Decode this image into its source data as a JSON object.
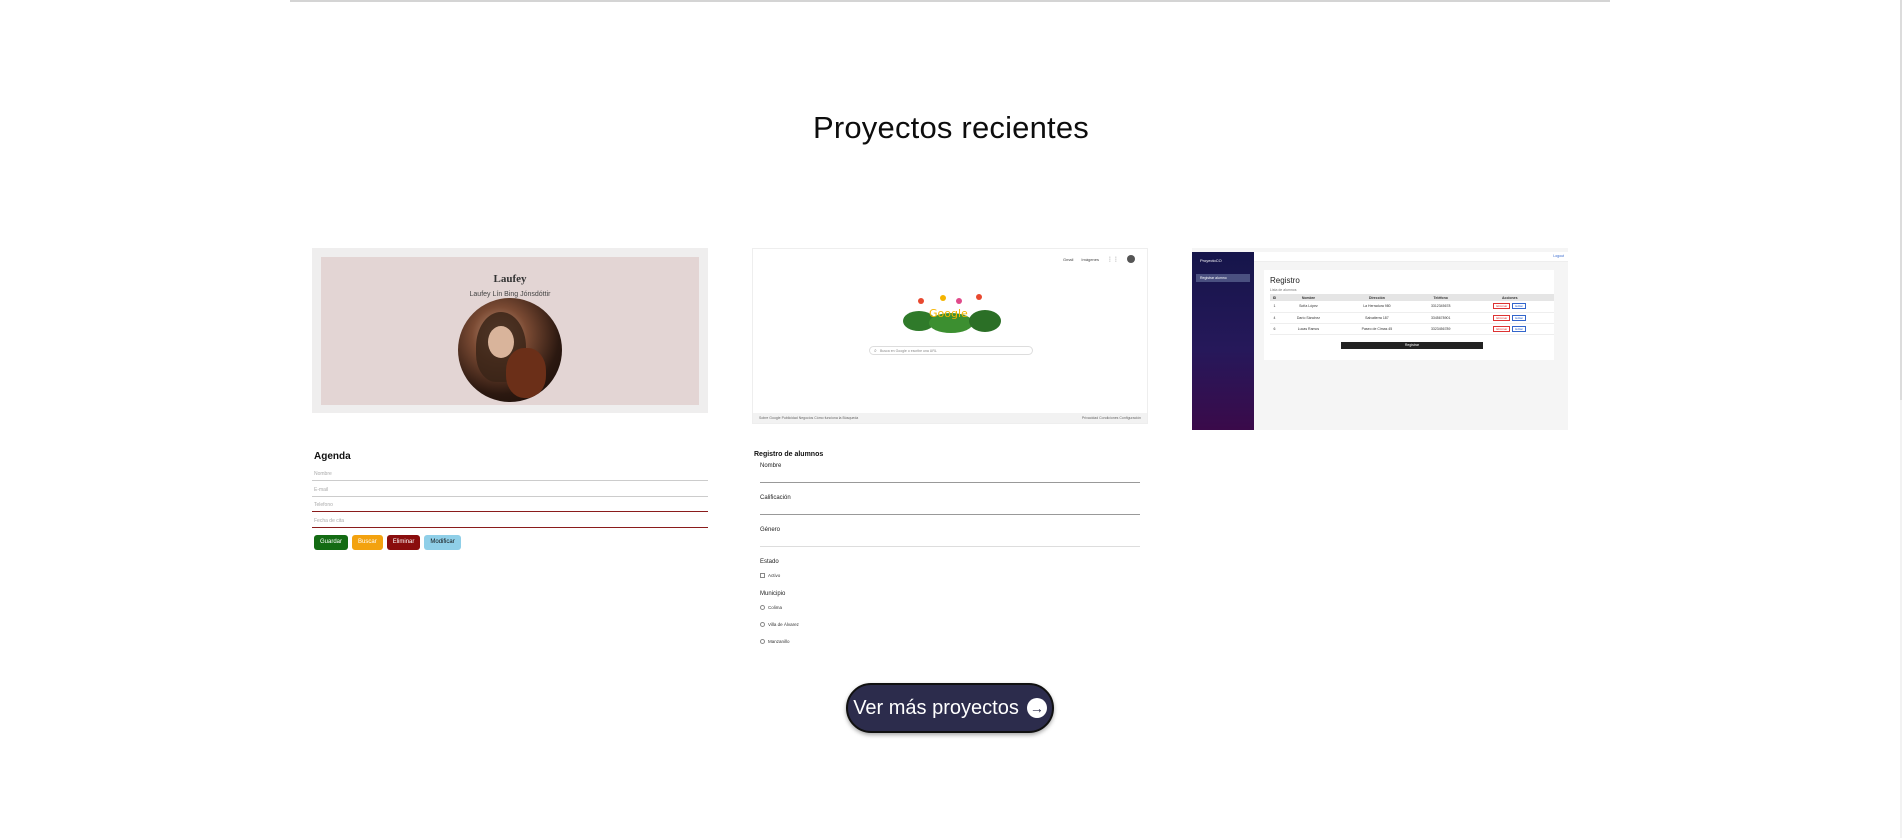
{
  "section": {
    "title": "Proyectos recientes"
  },
  "cards": {
    "laufey": {
      "name": "Laufey",
      "subtitle": "Laufey Lín Bing Jónsdóttir"
    },
    "google": {
      "toplinks": [
        "Gmail",
        "Imágenes"
      ],
      "search_placeholder": "Busca en Google o escribe una URL",
      "footer_left": "Sobre Google   Publicidad   Negocios   Cómo funciona la Búsqueda",
      "footer_right": "Privacidad   Condiciones   Configuración"
    },
    "registro": {
      "brand": "ProyectoCO",
      "nav_item": "Registrar alumno",
      "logout": "Logout",
      "title": "Registro",
      "subtitle": "Lista de alumnos",
      "columns": [
        "ID",
        "Nombre",
        "Dirección",
        "Teléfono",
        "Acciones"
      ],
      "rows": [
        [
          "1",
          "Sofía López",
          "La Herradura 980",
          "3312345678",
          [
            "Eliminar",
            "Editar"
          ]
        ],
        [
          "4",
          "Darío Sánchez",
          "Salvatierra 187",
          "3345678901",
          [
            "Eliminar",
            "Editar"
          ]
        ],
        [
          "6",
          "Lucas Ramos",
          "Paseo de Cimas 45",
          "3323456789",
          [
            "Eliminar",
            "Editar"
          ]
        ]
      ],
      "register_button": "Registrar"
    }
  },
  "agenda": {
    "title": "Agenda",
    "placeholders": [
      "Nombre",
      "E-mail",
      "Telefono",
      "Fecha de cita"
    ],
    "buttons": {
      "save": "Guardar",
      "find": "Buscar",
      "delete": "Eliminar",
      "modify": "Modificar"
    }
  },
  "alumnos": {
    "title": "Registro de alumnos",
    "labels": {
      "name": "Nombre",
      "grade": "Calificación",
      "gender": "Género",
      "status": "Estado",
      "municipality": "Municipio"
    },
    "status_option": "Activo",
    "municipalities": [
      "Colima",
      "Villa de Álvarez",
      "Manzanillo"
    ]
  },
  "cta": {
    "label": "Ver más proyectos",
    "icon": "arrow-right-icon"
  }
}
